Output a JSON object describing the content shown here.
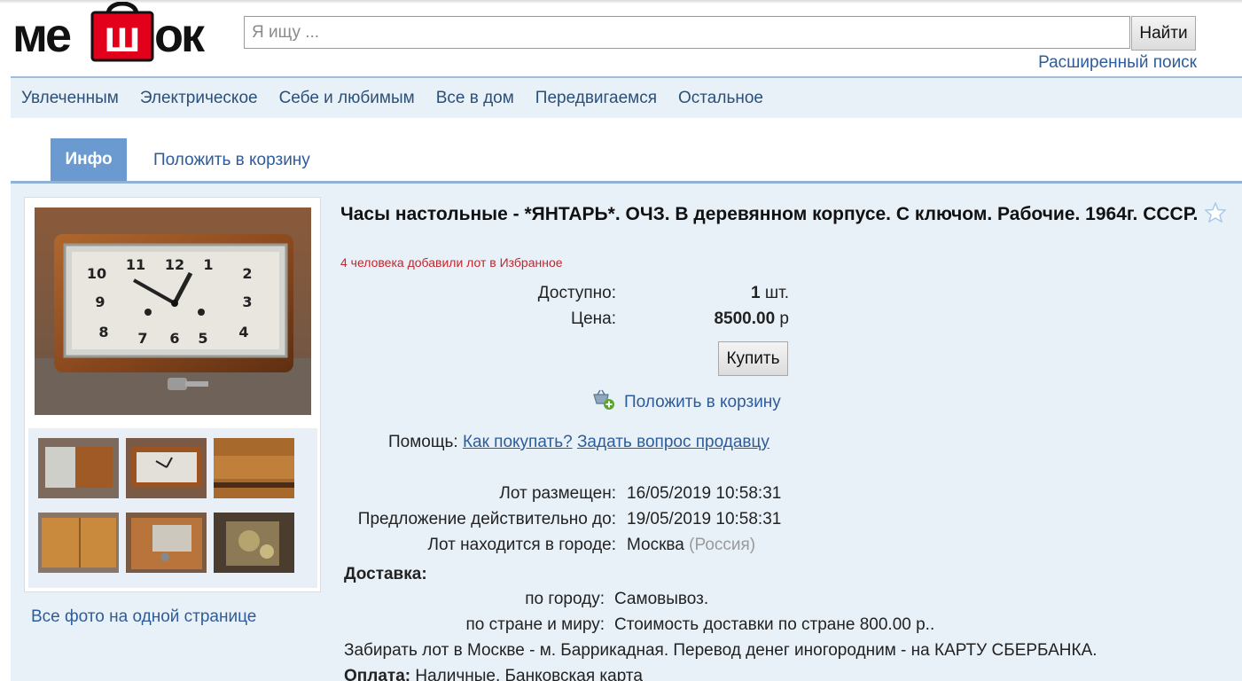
{
  "header": {
    "logo_text": "мешок",
    "search_placeholder": "Я ищу ...",
    "search_button": "Найти",
    "advanced_search": "Расширенный поиск"
  },
  "nav": {
    "items": [
      {
        "label": "Увлеченным"
      },
      {
        "label": "Электрическое"
      },
      {
        "label": "Себе и любимым"
      },
      {
        "label": "Все в дом"
      },
      {
        "label": "Передвигаемся"
      },
      {
        "label": "Остальное"
      }
    ]
  },
  "tabs": {
    "info": "Инфо",
    "cart": "Положить в корзину"
  },
  "gallery": {
    "all_photos": "Все фото на одной странице",
    "clock_numbers": [
      "12",
      "1",
      "2",
      "3",
      "4",
      "5",
      "6",
      "7",
      "8",
      "9",
      "10",
      "11"
    ]
  },
  "lot": {
    "title": "Часы настольные - *ЯНТАРЬ*. ОЧЗ. В деревянном корпусе. С ключом. Рабочие. 1964г. СССР.",
    "favorites_note": "4 человека добавили лот в Избранное",
    "available_label": "Доступно:",
    "available_value": "1",
    "available_unit": "шт.",
    "price_label": "Цена:",
    "price_value": "8500.00",
    "price_unit": "р",
    "buy_button": "Купить",
    "add_to_cart": "Положить в корзину",
    "help_label": "Помощь:",
    "help_how_to_buy": "Как покупать?",
    "help_ask_seller": "Задать вопрос продавцу",
    "posted_label": "Лот размещен:",
    "posted_value": "16/05/2019 10:58:31",
    "valid_until_label": "Предложение действительно до:",
    "valid_until_value": "19/05/2019 10:58:31",
    "city_label": "Лот находится в городе:",
    "city_value": "Москва",
    "country_value": "(Россия)",
    "delivery_heading": "Доставка:",
    "delivery_city_label": "по городу:",
    "delivery_city_value": "Самовывоз.",
    "delivery_world_label": "по стране и миру:",
    "delivery_world_value": "Стоимость доставки по стране 800.00 р..",
    "note": "Забирать лот в Москве - м. Баррикадная. Перевод денег иногородним - на КАРТУ СБЕРБАНКА.",
    "payment_label": "Оплата:",
    "payment_value": "Наличные, Банковская карта"
  },
  "colors": {
    "link": "#2e5c9a",
    "tab_active": "#6b9ad0",
    "nav_bg": "#e9f1f8",
    "logo_red": "#e2001a",
    "favorites_text": "#c0262d"
  }
}
